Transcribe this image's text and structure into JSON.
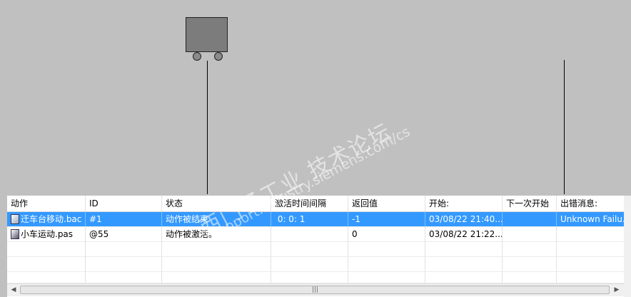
{
  "simulation": {
    "cart_label": "cart"
  },
  "watermark": {
    "line1": "西门子工业 技术论坛",
    "line2": "support.industry.siemens.com/cs"
  },
  "table": {
    "columns": [
      "动作",
      "ID",
      "状态",
      "激活时间间隔",
      "返回值",
      "开始:",
      "下一次开始",
      "出错消息:"
    ],
    "rows": [
      {
        "action": "迁车台移动.bac",
        "id": "#1",
        "status": "动作被结束",
        "interval": " 0: 0: 1",
        "retval": "-1",
        "start": "03/08/22 21:40...",
        "next": "",
        "error": "Unknown Failu...",
        "selected": true
      },
      {
        "action": "小车运动.pas",
        "id": "@55",
        "status": "动作被激活。",
        "interval": "",
        "retval": "0",
        "start": "03/08/22 21:22...",
        "next": "",
        "error": "",
        "selected": false
      }
    ]
  },
  "scrollbar": {
    "left_arrow": "◀",
    "right_arrow": "▶",
    "grip": "|||"
  }
}
